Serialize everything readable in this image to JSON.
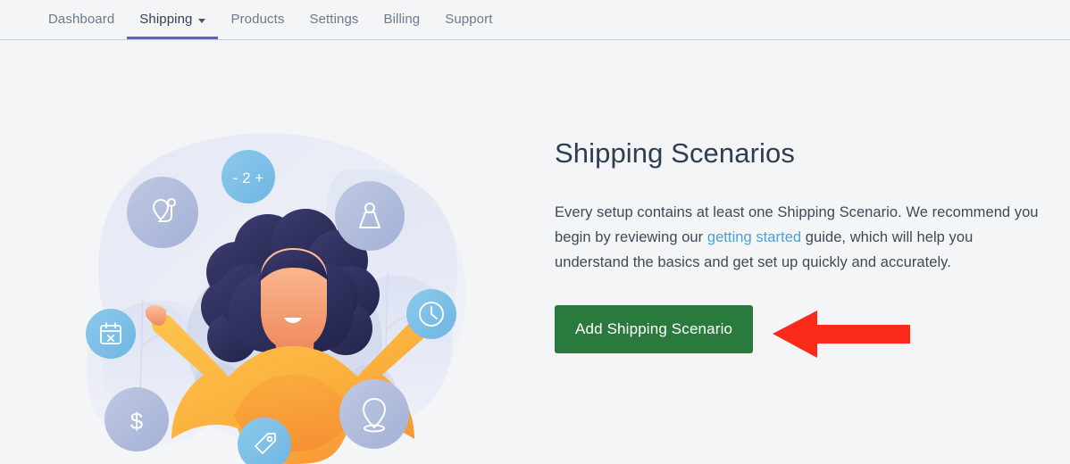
{
  "nav": {
    "items": [
      {
        "label": "Dashboard",
        "active": false,
        "has_caret": false
      },
      {
        "label": "Shipping",
        "active": true,
        "has_caret": true
      },
      {
        "label": "Products",
        "active": false,
        "has_caret": false
      },
      {
        "label": "Settings",
        "active": false,
        "has_caret": false
      },
      {
        "label": "Billing",
        "active": false,
        "has_caret": false
      },
      {
        "label": "Support",
        "active": false,
        "has_caret": false
      }
    ],
    "active_underline_color": "#5a64c8"
  },
  "panel": {
    "title": "Shipping Scenarios",
    "paragraph_before_link": "Every setup contains at least one Shipping Scenario. We recommend you begin by reviewing our ",
    "link_text": "getting started",
    "paragraph_after_link": " guide, which will help you understand the basics and get set up quickly and accurately.",
    "link_color": "#4e9fd1",
    "button_label": "Add Shipping Scenario",
    "button_color": "#2a7a3d"
  },
  "annotation": {
    "arrow_direction": "left",
    "arrow_color": "#fa2b1a"
  },
  "illustration": {
    "quantity_stepper_text": "- 2 +",
    "dollar_text": "$",
    "badges": [
      {
        "name": "route-location-icon",
        "color": "#aab6d8"
      },
      {
        "name": "quantity-stepper-badge",
        "color": "#7cc0e8"
      },
      {
        "name": "weight-icon",
        "color": "#a9b8da"
      },
      {
        "name": "calendar-icon",
        "color": "#7cc0e8"
      },
      {
        "name": "clock-icon",
        "color": "#7cc0e8"
      },
      {
        "name": "dollar-icon",
        "color": "#aab6d8"
      },
      {
        "name": "price-tag-icon",
        "color": "#7cc0e8"
      },
      {
        "name": "map-pin-icon",
        "color": "#aab6d8"
      }
    ],
    "character": {
      "hair_color": "#2d2f5e",
      "skin_color": "#f5a173",
      "dress_color": "#fbb13f"
    }
  },
  "theme": {
    "page_background": "#f4f5f7",
    "header_border": "#c7cfdb",
    "nav_text": "#6b7a8d",
    "nav_text_active": "#313f52",
    "title_color": "#2d3e50",
    "body_text": "#3d4a56"
  }
}
